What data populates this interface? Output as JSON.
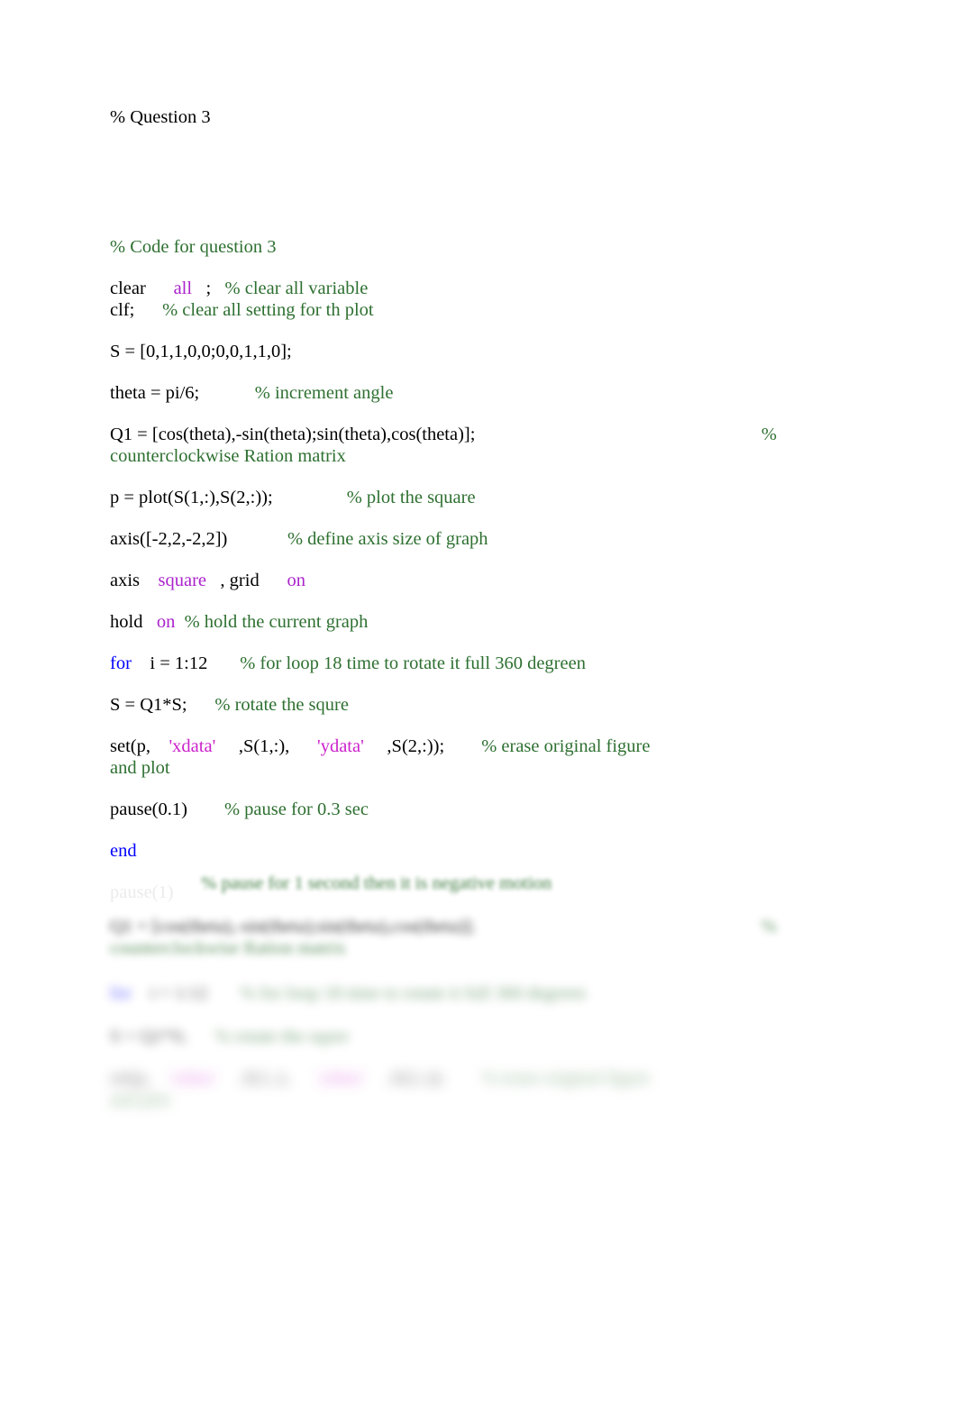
{
  "document": {
    "title_comment": "% Question 3",
    "section_comment": "% Code for question 3",
    "colors": {
      "comment": "#2e7031",
      "keyword": "#0000ff",
      "option": "#aa22cc",
      "string": "#cc22cc",
      "code": "#000000",
      "background": "#ffffff"
    },
    "lines": {
      "clear_code": "clear",
      "clear_all": "all",
      "clear_semi": ";",
      "clear_comment": "% clear all variable",
      "clf_code": "clf;",
      "clf_comment": "% clear all setting for th plot",
      "matrix_s": "S = [0,1,1,0,0;0,0,1,1,0];",
      "theta_code": "theta = pi/6;",
      "theta_comment": "% increment angle",
      "q1_code": "Q1 = [cos(theta),-sin(theta);sin(theta),cos(theta)];",
      "q1_percent": "%",
      "q1_comment_wrap": "counterclockwise Ration matrix",
      "plot_code": "p = plot(S(1,:),S(2,:));",
      "plot_comment": "% plot the square",
      "axis_code": "axis([-2,2,-2,2])",
      "axis_comment": "% define axis size of graph",
      "axis2_code": "axis",
      "axis2_square": "square",
      "axis2_grid": ", grid",
      "axis2_on": "on",
      "hold_code": "hold",
      "hold_on": "on",
      "hold_comment": "% hold the current graph",
      "for_kw": "for",
      "for_code": "i = 1:12",
      "for_comment": "% for loop 18 time to rotate it full 360 degreen",
      "rotate_code": "S = Q1*S;",
      "rotate_comment": "% rotate the squre",
      "set_open": "set(p,",
      "set_xdata": "'xdata'",
      "set_mid1": ",S(1,:),",
      "set_ydata": "'ydata'",
      "set_mid2": ",S(2,:));",
      "set_comment": "% erase original figure",
      "set_comment_wrap": "and plot",
      "pause_code": "pause(0.1)",
      "pause_comment": "% pause for 0.3 sec",
      "end_kw": "end",
      "pause1_code": "pause(1)",
      "pause1_comment": "% pause for 1 second then it is negative motion"
    }
  }
}
